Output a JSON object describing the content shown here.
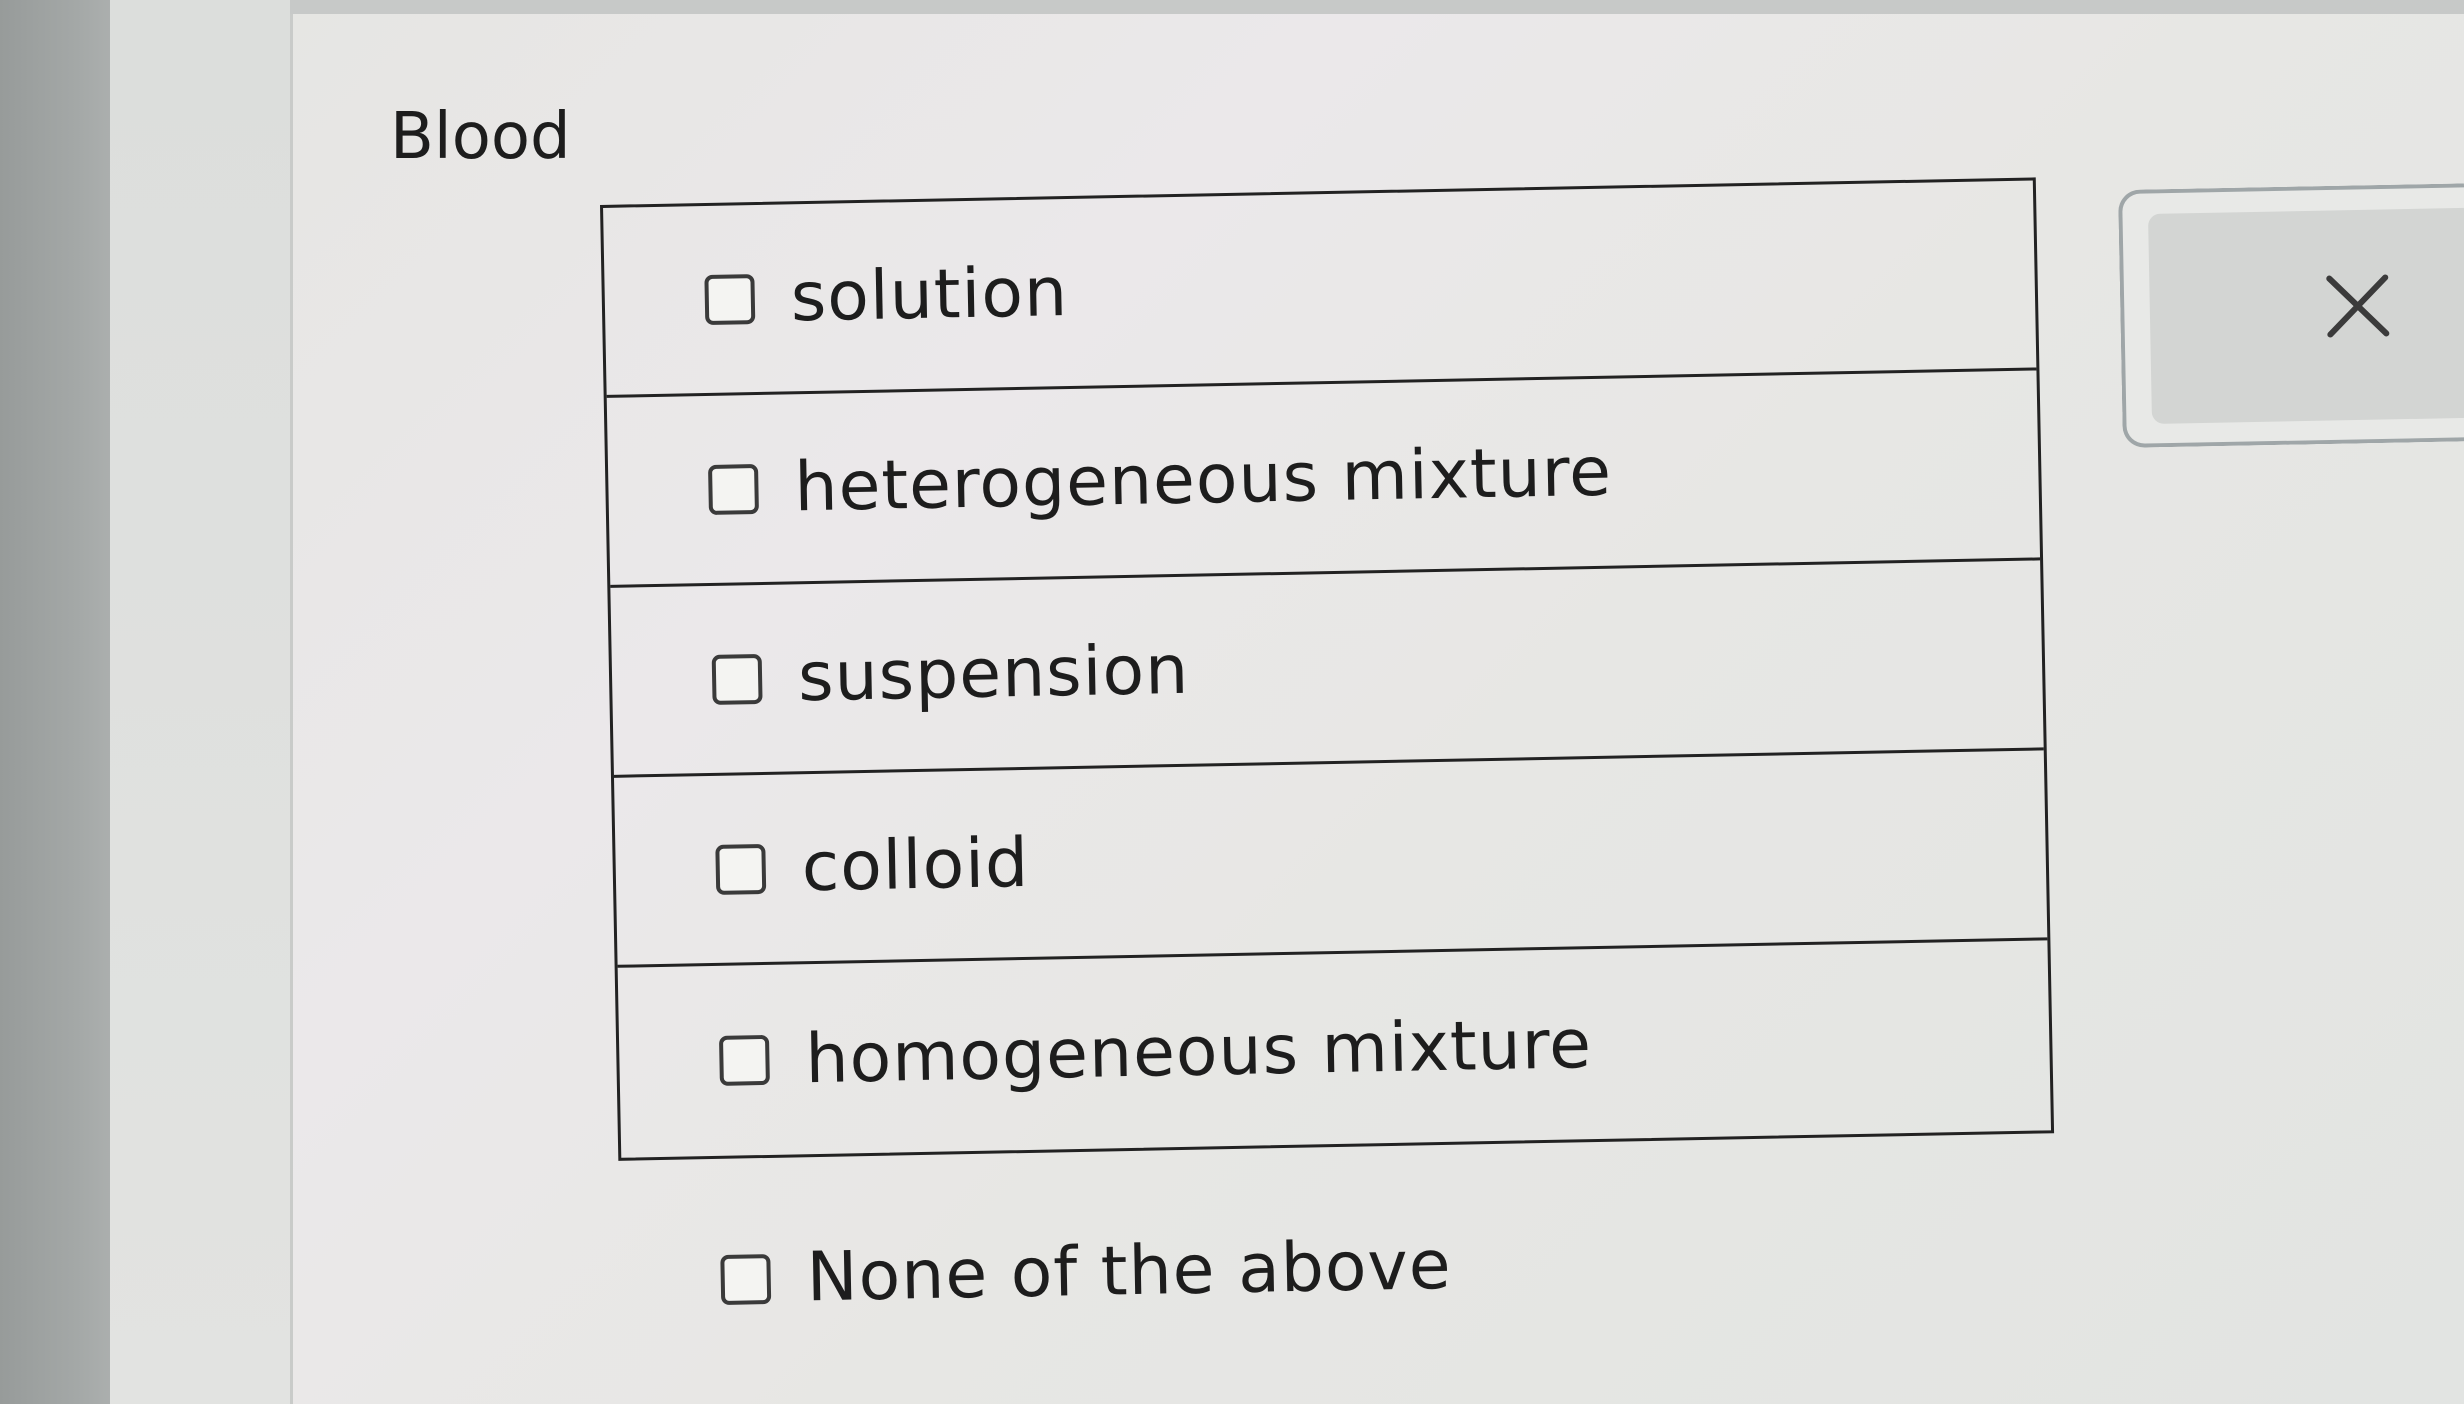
{
  "question": {
    "title": "Blood"
  },
  "options": [
    {
      "label": "solution",
      "checked": false
    },
    {
      "label": "heterogeneous mixture",
      "checked": false
    },
    {
      "label": "suspension",
      "checked": false
    },
    {
      "label": "colloid",
      "checked": false
    },
    {
      "label": "homogeneous mixture",
      "checked": false
    }
  ],
  "none_option": {
    "label": "None of the above",
    "checked": false
  },
  "close_button": {
    "icon": "close-icon"
  },
  "colors": {
    "text": "#1d1d1d",
    "border": "#222222",
    "close_panel_border": "#9fa6a8",
    "close_button_bg": "#d3d5d3"
  }
}
